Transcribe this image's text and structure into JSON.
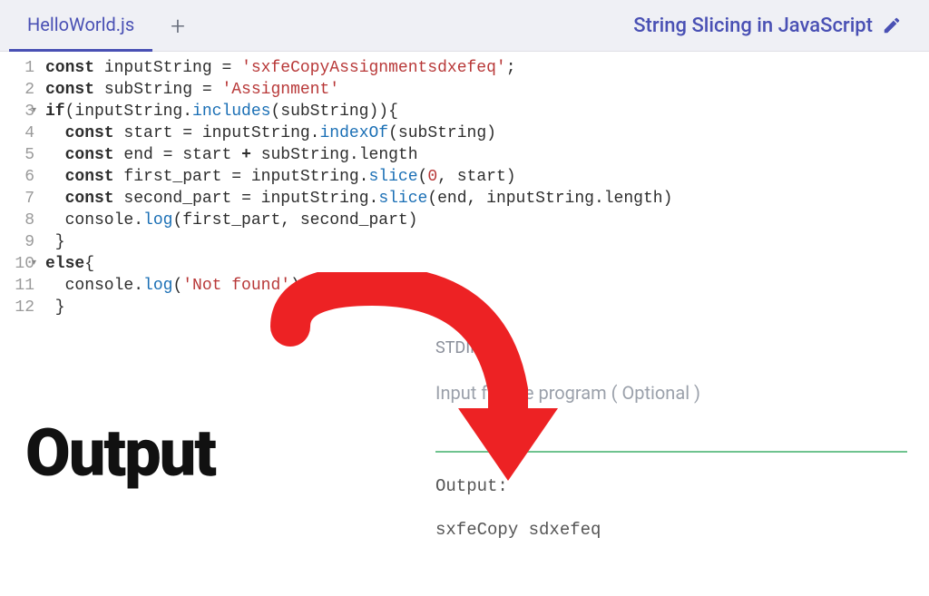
{
  "header": {
    "tab_name": "HelloWorld.js",
    "title": "String Slicing in JavaScript"
  },
  "editor": {
    "line_numbers": [
      "1",
      "2",
      "3",
      "4",
      "5",
      "6",
      "7",
      "8",
      "9",
      "10",
      "11",
      "12"
    ],
    "code": {
      "l1_kw": "const",
      "l1_var": " inputString ",
      "l1_eq": "=",
      "l1_str": " 'sxfeCopyAssignmentsdxefeq'",
      "l1_end": ";",
      "l2_kw": "const",
      "l2_var": " subString ",
      "l2_eq": "=",
      "l2_str": " 'Assignment'",
      "l3_kw": "if",
      "l3_a": "(inputString.",
      "l3_fn": "includes",
      "l3_b": "(subString)){",
      "l4_kw": "  const",
      "l4_var": " start ",
      "l4_eq": "=",
      "l4_a": " inputString.",
      "l4_fn": "indexOf",
      "l4_b": "(subString)",
      "l5_kw": "  const",
      "l5_var": " end ",
      "l5_eq": "=",
      "l5_a": " start ",
      "l5_plus": "+",
      "l5_b": " subString.length",
      "l6_kw": "  const",
      "l6_var": " first_part ",
      "l6_eq": "=",
      "l6_a": " inputString.",
      "l6_fn": "slice",
      "l6_b": "(",
      "l6_num": "0",
      "l6_c": ", start)",
      "l7_kw": "  const",
      "l7_var": " second_part ",
      "l7_eq": "=",
      "l7_a": " inputString.",
      "l7_fn": "slice",
      "l7_b": "(end, inputString.length)",
      "l8_a": "  console.",
      "l8_fn": "log",
      "l8_b": "(first_part, second_part)",
      "l9": " }",
      "l10_kw": "else",
      "l10_b": "{",
      "l11_a": "  console.",
      "l11_fn": "log",
      "l11_b": "(",
      "l11_str": "'Not found'",
      "l11_c": ")",
      "l12": " }"
    }
  },
  "panel": {
    "stdin_label": "STDIN",
    "stdin_placeholder": "Input for the program ( Optional )",
    "annotation": "Output",
    "output_label": "Output:",
    "output_value": "sxfeCopy sdxefeq"
  }
}
